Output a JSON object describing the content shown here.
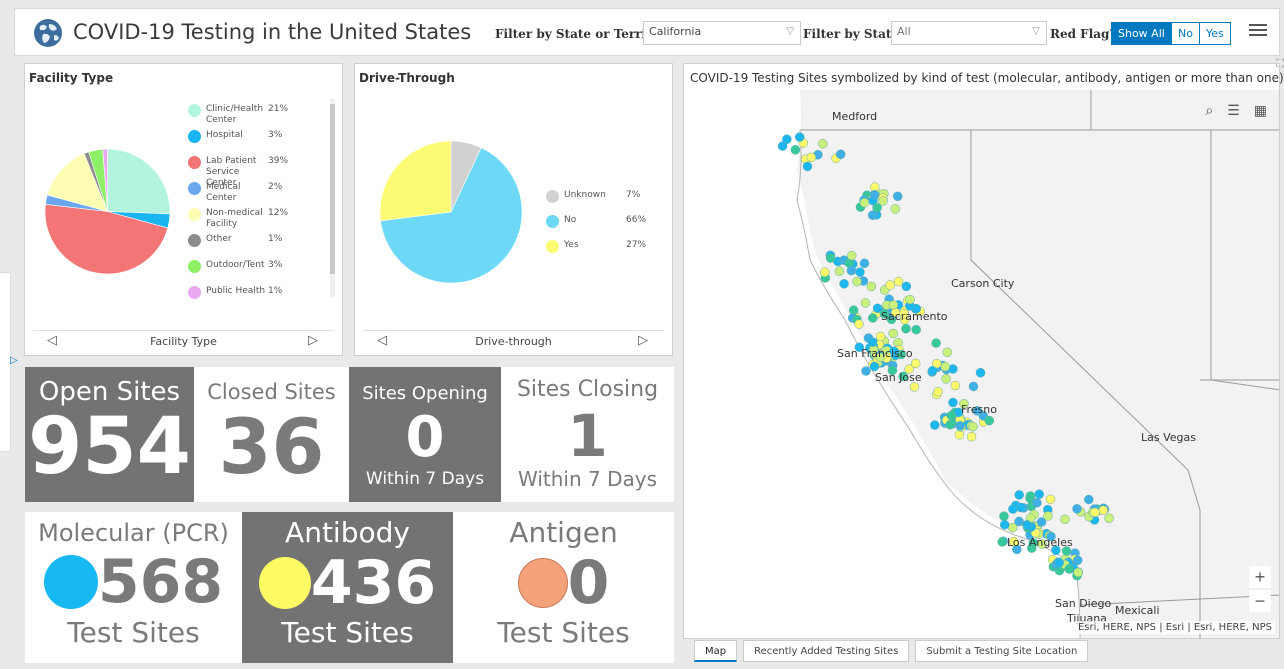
{
  "header": {
    "title": "COVID-19 Testing in the United States",
    "state_label": "Filter by State or Territory",
    "state_value": "California",
    "status_label": "Filter by Status",
    "status_value": "All",
    "redflag_label": "Red Flag?",
    "buttons": [
      "Show All",
      "No",
      "Yes"
    ]
  },
  "facility": {
    "title": "Facility Type",
    "pager_label": "Facility Type",
    "items": [
      {
        "name": "Clinic/Health Center",
        "pct": "21%",
        "color": "#b3f5dc",
        "value": 21
      },
      {
        "name": "Hospital",
        "pct": "3%",
        "color": "#18b5f0",
        "value": 3
      },
      {
        "name": "Lab Patient Service Center",
        "pct": "39%",
        "color": "#f47575",
        "value": 39
      },
      {
        "name": "Medical Center",
        "pct": "2%",
        "color": "#6ba7ef",
        "value": 2
      },
      {
        "name": "Non-medical Facility",
        "pct": "12%",
        "color": "#fdfcb3",
        "value": 12
      },
      {
        "name": "Other",
        "pct": "1%",
        "color": "#8c8c8c",
        "value": 1
      },
      {
        "name": "Outdoor/Tent",
        "pct": "3%",
        "color": "#8ef067",
        "value": 3
      },
      {
        "name": "Public Health",
        "pct": "1%",
        "color": "#e8a9f0",
        "value": 1
      }
    ]
  },
  "drive": {
    "title": "Drive-Through",
    "pager_label": "Drive-through",
    "items": [
      {
        "name": "Unknown",
        "pct": "7%",
        "color": "#d1d1d1",
        "value": 7
      },
      {
        "name": "No",
        "pct": "66%",
        "color": "#6ed8f7",
        "value": 66
      },
      {
        "name": "Yes",
        "pct": "27%",
        "color": "#fdfb74",
        "value": 27
      }
    ]
  },
  "stats": [
    {
      "label": "Open Sites",
      "value": "954",
      "sub": ""
    },
    {
      "label": "Closed Sites",
      "value": "36",
      "sub": ""
    },
    {
      "label": "Sites Opening",
      "value": "0",
      "sub": "Within 7 Days"
    },
    {
      "label": "Sites Closing",
      "value": "1",
      "sub": "Within 7 Days"
    }
  ],
  "tests": [
    {
      "label": "Molecular (PCR)",
      "value": "568",
      "sub": "Test Sites",
      "color": "#18b8f3"
    },
    {
      "label": "Antibody",
      "value": "436",
      "sub": "Test Sites",
      "color": "#fdfb64"
    },
    {
      "label": "Antigen",
      "value": "0",
      "sub": "Test Sites",
      "color": "#f5a27a"
    }
  ],
  "map": {
    "title": "COVID-19 Testing Sites symbolized by kind of test (molecular, antibody, antigen or more than one)",
    "attribution": "Esri, HERE, NPS | Esri | Esri, HERE, NPS",
    "cities": [
      "Medford",
      "Carson City",
      "Sacramento",
      "San Francisco",
      "San Jose",
      "Fresno",
      "Las Vegas",
      "Los Angeles",
      "San Diego",
      "Tijuana",
      "Mexicali"
    ],
    "tabs": [
      "Map",
      "Recently Added Testing Sites",
      "Submit a Testing Site Location"
    ]
  }
}
